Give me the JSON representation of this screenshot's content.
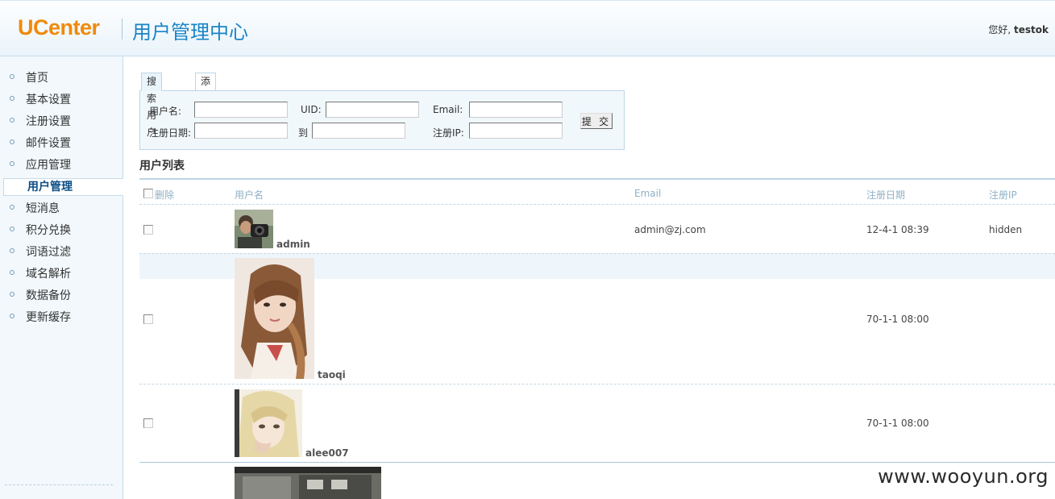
{
  "header": {
    "logo": "UCenter",
    "title": "用户管理中心",
    "greeting_prefix": "您好,",
    "username": "testok"
  },
  "sidebar": {
    "items": [
      {
        "label": "首页"
      },
      {
        "label": "基本设置"
      },
      {
        "label": "注册设置"
      },
      {
        "label": "邮件设置"
      },
      {
        "label": "应用管理"
      },
      {
        "label": "用户管理",
        "active": true
      },
      {
        "label": "短消息"
      },
      {
        "label": "积分兑换"
      },
      {
        "label": "词语过滤"
      },
      {
        "label": "域名解析"
      },
      {
        "label": "数据备份"
      },
      {
        "label": "更新缓存"
      }
    ]
  },
  "tabs": [
    "搜索用户",
    "添加用户"
  ],
  "search_form": {
    "username_label": "用户名:",
    "uid_label": "UID:",
    "email_label": "Email:",
    "regdate_label": "注册日期:",
    "to_label": "到",
    "regip_label": "注册IP:",
    "submit_label": "提 交"
  },
  "list": {
    "title": "用户列表",
    "columns": {
      "delete": "删除",
      "username": "用户名",
      "email": "Email",
      "regdate": "注册日期",
      "regip": "注册IP"
    },
    "rows": [
      {
        "username": "admin",
        "email": "admin@zj.com",
        "regdate": "12-4-1 08:39",
        "regip": "hidden"
      },
      {
        "username": "taoqi",
        "email": "",
        "regdate": "70-1-1 08:00",
        "regip": ""
      },
      {
        "username": "alee007",
        "email": "",
        "regdate": "70-1-1 08:00",
        "regip": ""
      }
    ]
  },
  "watermark": "www.wooyun.org"
}
